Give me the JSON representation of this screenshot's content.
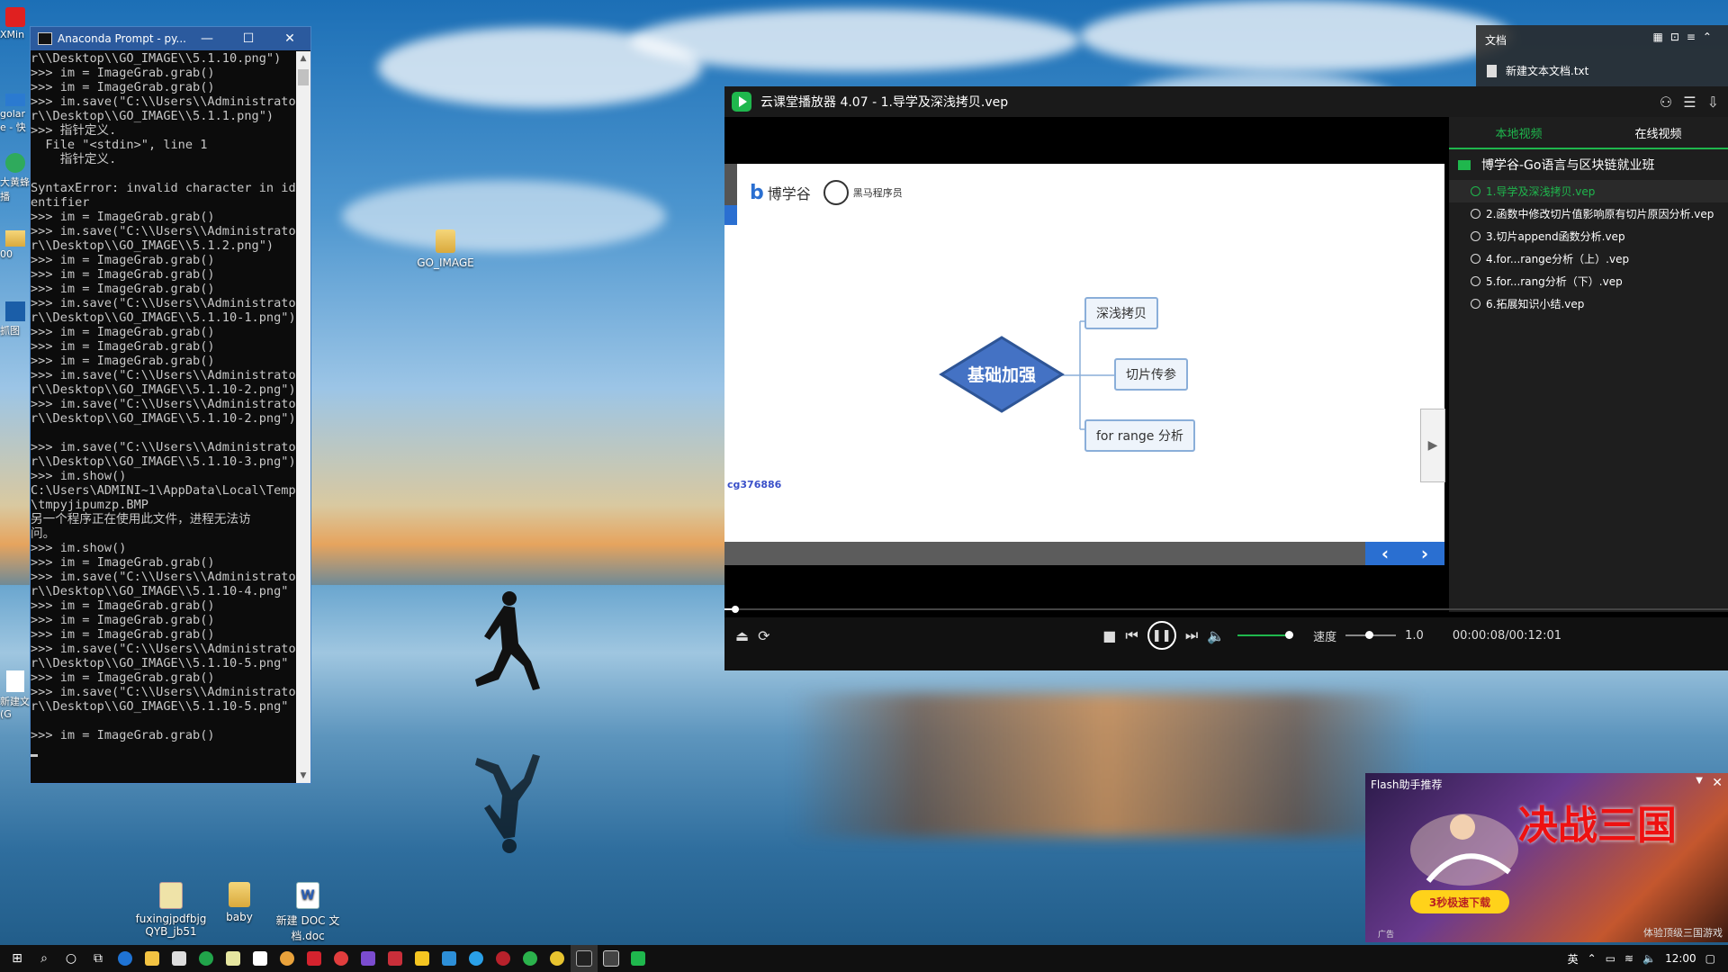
{
  "desktop": {
    "icons": [
      {
        "label": "GO_IMAGE"
      },
      {
        "label": "fuxingjpdfbjgQYB_jb51"
      },
      {
        "label": "baby"
      },
      {
        "label": "新建 DOC 文档.doc"
      }
    ],
    "left_strip": [
      "XMin",
      "golar",
      "e - 快",
      "大黄蜂",
      "播",
      "00",
      "抓图",
      "新建文",
      "(G"
    ]
  },
  "console": {
    "title": "Anaconda Prompt - py...",
    "lines": [
      "r\\\\Desktop\\\\GO_IMAGE\\\\5.1.10.png\")",
      ">>> im = ImageGrab.grab()",
      ">>> im = ImageGrab.grab()",
      ">>> im.save(\"C:\\\\Users\\\\Administrato",
      "r\\\\Desktop\\\\GO_IMAGE\\\\5.1.1.png\")",
      ">>> 指针定义.",
      "  File \"<stdin>\", line 1",
      "    指针定义.",
      "",
      "SyntaxError: invalid character in id",
      "entifier",
      ">>> im = ImageGrab.grab()",
      ">>> im.save(\"C:\\\\Users\\\\Administrato",
      "r\\\\Desktop\\\\GO_IMAGE\\\\5.1.2.png\")",
      ">>> im = ImageGrab.grab()",
      ">>> im = ImageGrab.grab()",
      ">>> im = ImageGrab.grab()",
      ">>> im.save(\"C:\\\\Users\\\\Administrato",
      "r\\\\Desktop\\\\GO_IMAGE\\\\5.1.10-1.png\")",
      ">>> im = ImageGrab.grab()",
      ">>> im = ImageGrab.grab()",
      ">>> im = ImageGrab.grab()",
      ">>> im.save(\"C:\\\\Users\\\\Administrato",
      "r\\\\Desktop\\\\GO_IMAGE\\\\5.1.10-2.png\")",
      ">>> im.save(\"C:\\\\Users\\\\Administrato",
      "r\\\\Desktop\\\\GO_IMAGE\\\\5.1.10-2.png\")",
      "",
      ">>> im.save(\"C:\\\\Users\\\\Administrato",
      "r\\\\Desktop\\\\GO_IMAGE\\\\5.1.10-3.png\")",
      ">>> im.show()",
      "C:\\Users\\ADMINI~1\\AppData\\Local\\Temp",
      "\\tmpyjipumzp.BMP",
      "另一个程序正在使用此文件，进程无法访",
      "问。",
      ">>> im.show()",
      ">>> im = ImageGrab.grab()",
      ">>> im.save(\"C:\\\\Users\\\\Administrato",
      "r\\\\Desktop\\\\GO_IMAGE\\\\5.1.10-4.png\"",
      ">>> im = ImageGrab.grab()",
      ">>> im = ImageGrab.grab()",
      ">>> im = ImageGrab.grab()",
      ">>> im.save(\"C:\\\\Users\\\\Administrato",
      "r\\\\Desktop\\\\GO_IMAGE\\\\5.1.10-5.png\"",
      ">>> im = ImageGrab.grab()",
      ">>> im.save(\"C:\\\\Users\\\\Administrato",
      "r\\\\Desktop\\\\GO_IMAGE\\\\5.1.10-5.png\"",
      "",
      ">>> im = ImageGrab.grab()"
    ],
    "controls": {
      "minimize": "—",
      "maximize": "☐",
      "close": "✕"
    }
  },
  "player": {
    "title": "云课堂播放器 4.07 - 1.导学及深浅拷贝.vep",
    "slide": {
      "logo1": "博学谷",
      "logo2": "黑马程序员",
      "center_node": "基础加强",
      "nodes": [
        "深浅拷贝",
        "切片传参",
        "for  range 分析"
      ],
      "watermark": "cg376886",
      "prev": "‹",
      "next": "›"
    },
    "tabs": [
      "本地视频",
      "在线视频"
    ],
    "folder": "博学谷-Go语言与区块链就业班",
    "items": [
      "1.导学及深浅拷贝.vep",
      "2.函数中修改切片值影响原有切片原因分析.vep",
      "3.切片append函数分析.vep",
      "4.for...range分析（上）.vep",
      "5.for...rang分析（下）.vep",
      "6.拓展知识小结.vep"
    ],
    "controls": {
      "speed_label": "速度",
      "speed_value": "1.0",
      "time": "00:00:08/00:12:01"
    },
    "progress_fraction": 0.011
  },
  "notification": {
    "title": "文档",
    "file": "新建文本文档.txt"
  },
  "ad": {
    "header": "Flash助手推荐",
    "headline": "决战三国",
    "download": "3秒极速下载",
    "footer": "体验顶级三国游戏",
    "tag": "广告"
  },
  "taskbar": {
    "time": "12:00",
    "input": "英"
  }
}
